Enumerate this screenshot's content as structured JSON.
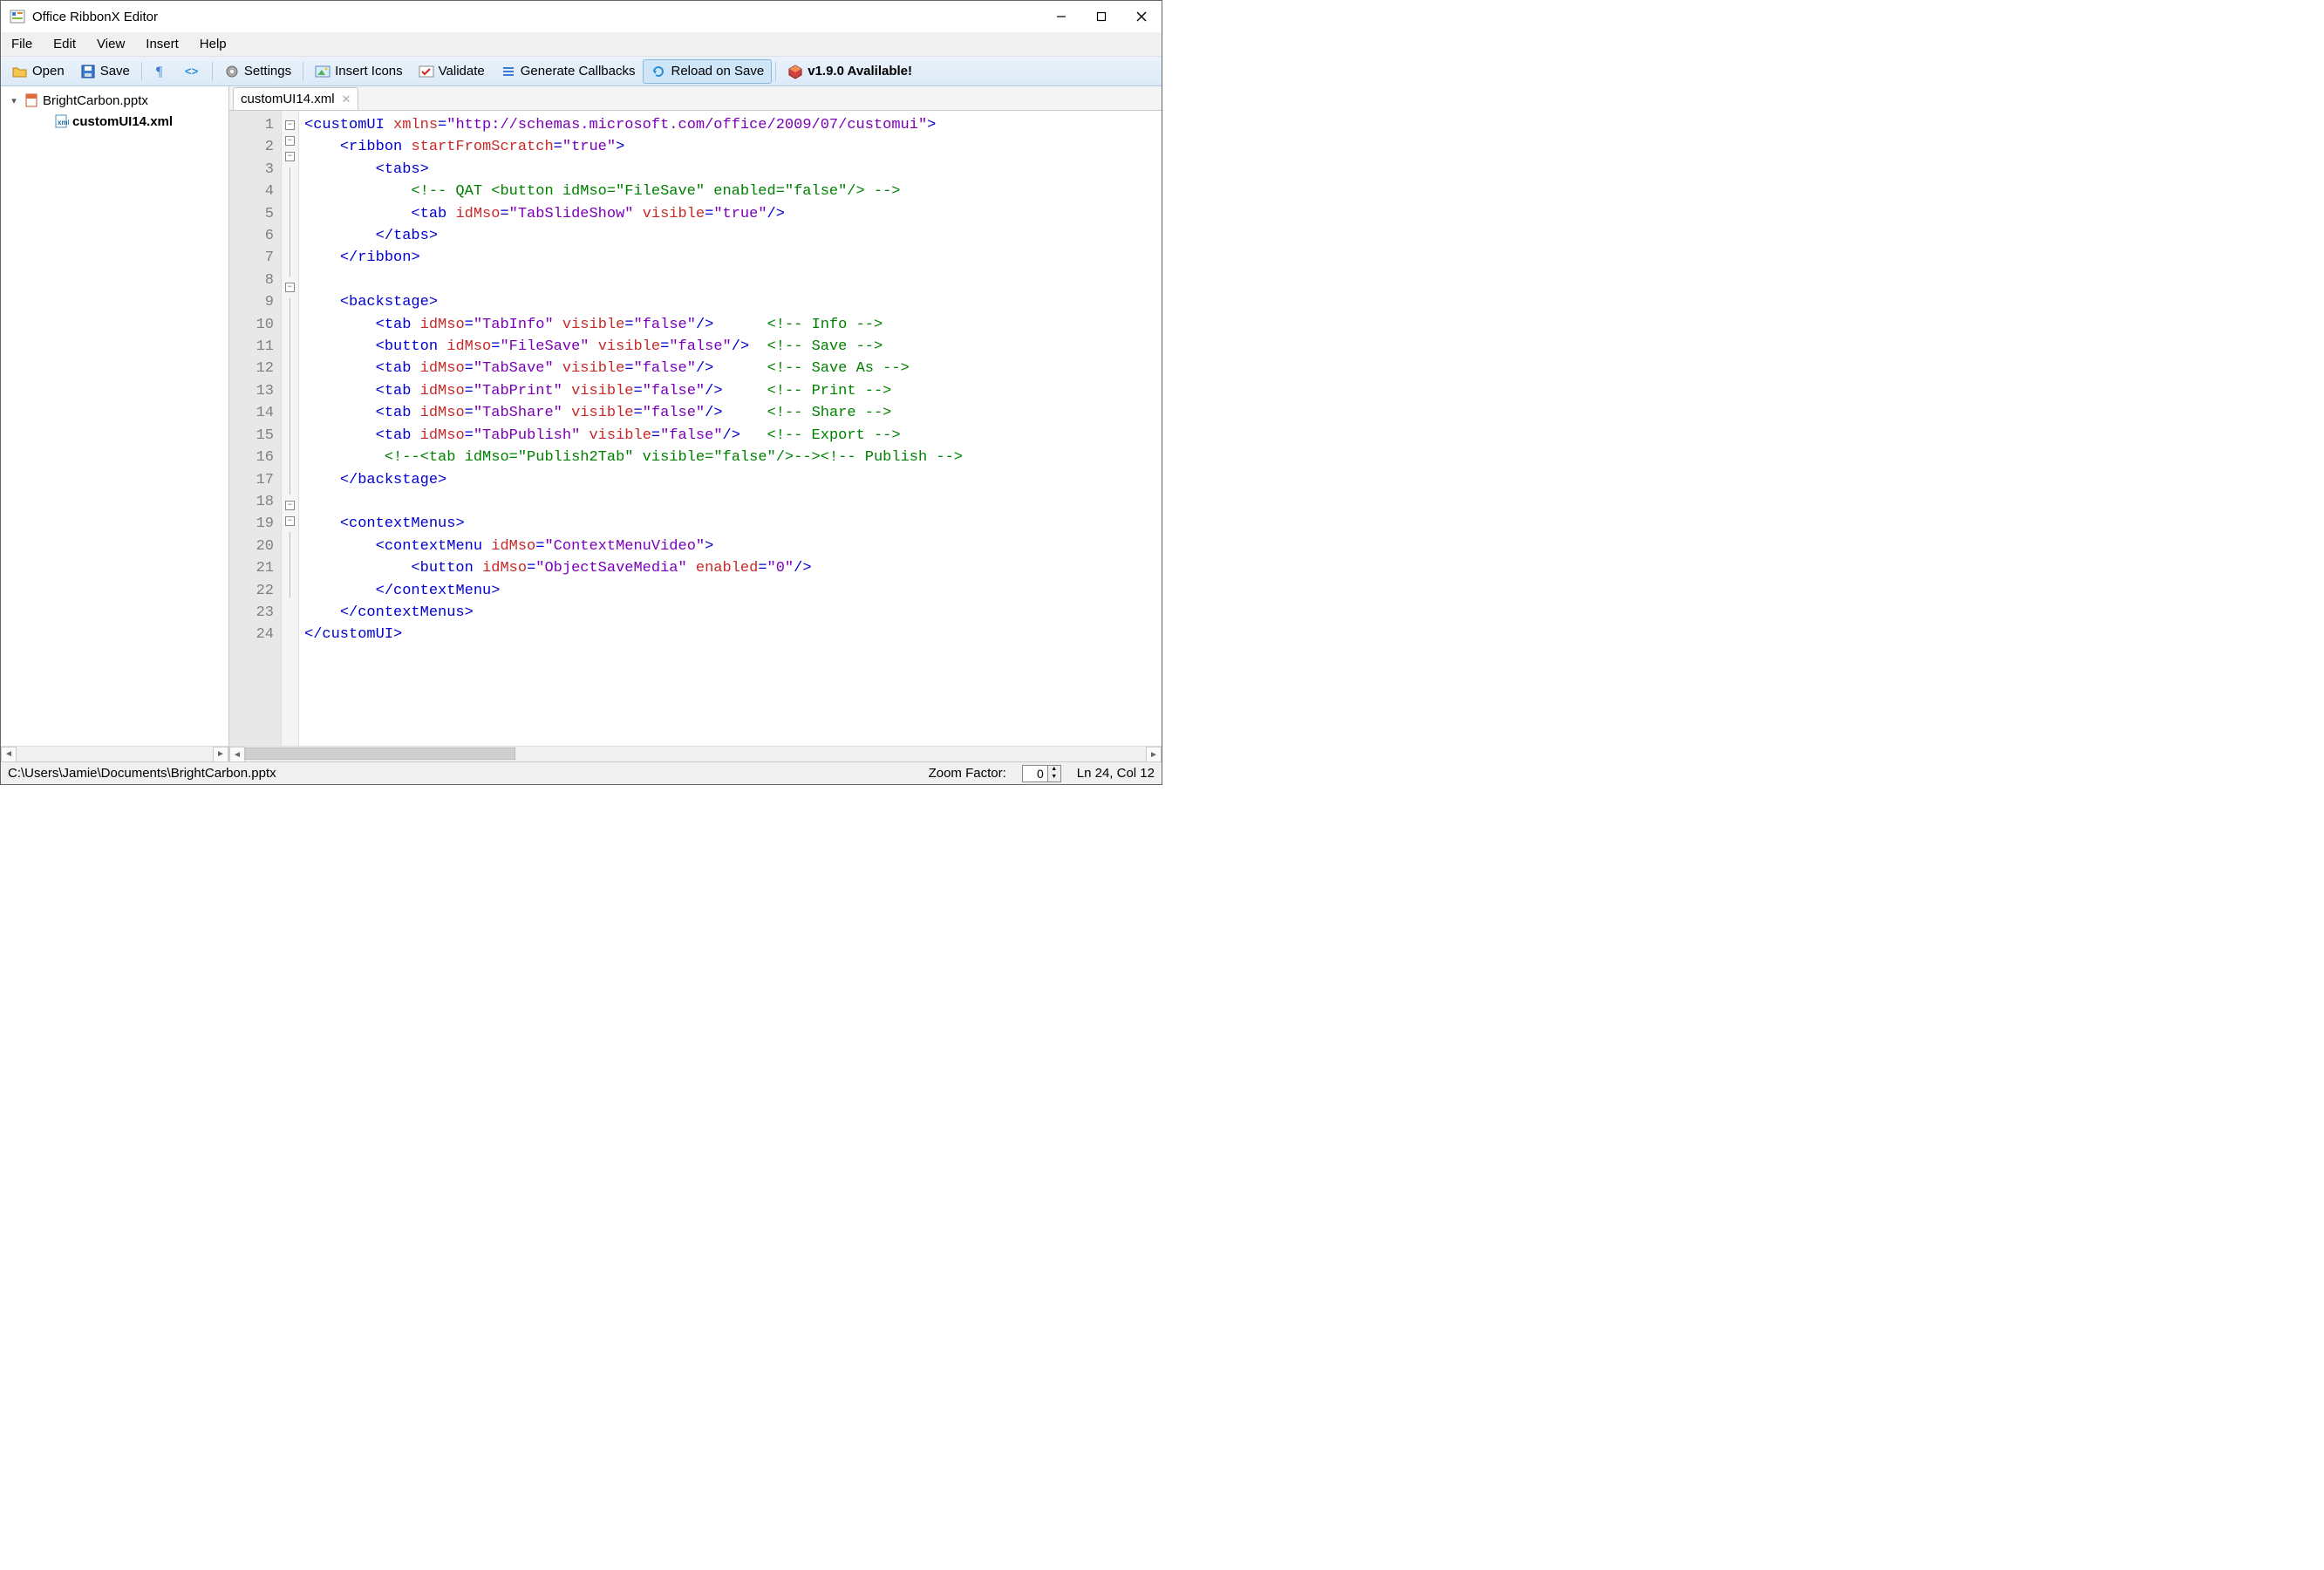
{
  "app": {
    "title": "Office RibbonX Editor"
  },
  "menu": {
    "file": "File",
    "edit": "Edit",
    "view": "View",
    "insert": "Insert",
    "help": "Help"
  },
  "toolbar": {
    "open": "Open",
    "save": "Save",
    "settings": "Settings",
    "insert_icons": "Insert Icons",
    "validate": "Validate",
    "gen_callbacks": "Generate Callbacks",
    "reload": "Reload on Save",
    "version": "v1.9.0 Avalilable!"
  },
  "tree": {
    "root_label": "BrightCarbon.pptx",
    "child_label": "customUI14.xml"
  },
  "tabbar": {
    "tab1": "customUI14.xml"
  },
  "code": {
    "line_count": 24,
    "tokens": {
      "customUI": "customUI",
      "xmlns": "xmlns",
      "xmlns_val": "\"http://schemas.microsoft.com/office/2009/07/customui\"",
      "ribbon": "ribbon",
      "startFromScratch": "startFromScratch",
      "true": "\"true\"",
      "tabs": "tabs",
      "tab": "tab",
      "idMso": "idMso",
      "visible": "visible",
      "enabled": "enabled",
      "button": "button",
      "backstage": "backstage",
      "contextMenus": "contextMenus",
      "contextMenu": "contextMenu",
      "false": "\"false\"",
      "zero": "\"0\"",
      "v_TabSlideShow": "\"TabSlideShow\"",
      "v_TabInfo": "\"TabInfo\"",
      "v_FileSave": "\"FileSave\"",
      "v_TabSave": "\"TabSave\"",
      "v_TabPrint": "\"TabPrint\"",
      "v_TabShare": "\"TabShare\"",
      "v_TabPublish": "\"TabPublish\"",
      "v_Publish2Tab": "\"Publish2Tab\"",
      "v_ContextMenuVideo": "\"ContextMenuVideo\"",
      "v_ObjectSaveMedia": "\"ObjectSaveMedia\"",
      "c_qat": "<!-- QAT <button idMso=\"FileSave\" enabled=\"false\"/> -->",
      "c_info": "<!-- Info -->",
      "c_save": "<!-- Save -->",
      "c_saveas": "<!-- Save As -->",
      "c_print": "<!-- Print -->",
      "c_share": "<!-- Share -->",
      "c_export": "<!-- Export -->",
      "c_pub_open": "<!--",
      "c_pub_close": "-->",
      "c_publish": "<!-- Publish -->"
    }
  },
  "status": {
    "path": "C:\\Users\\Jamie\\Documents\\BrightCarbon.pptx",
    "zoom_label": "Zoom Factor:",
    "zoom_value": "0",
    "cursor": "Ln 24,  Col 12"
  }
}
